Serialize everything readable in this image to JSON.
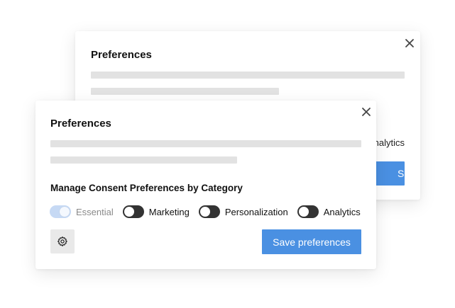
{
  "back_dialog": {
    "title": "Preferences",
    "peek_toggle_label": "Analytics",
    "peek_button_label": "Save preferences"
  },
  "front_dialog": {
    "title": "Preferences",
    "section_title": "Manage Consent Preferences by Category",
    "categories": [
      {
        "label": "Essential",
        "enabled": true,
        "disabled": true
      },
      {
        "label": "Marketing",
        "enabled": false,
        "disabled": false
      },
      {
        "label": "Personalization",
        "enabled": false,
        "disabled": false
      },
      {
        "label": "Analytics",
        "enabled": false,
        "disabled": false
      }
    ],
    "save_button_label": "Save preferences"
  },
  "colors": {
    "accent": "#4a90e2",
    "toggle_off": "#333333",
    "toggle_on_disabled": "#c6d9f4",
    "placeholder": "#e2e2e2"
  }
}
